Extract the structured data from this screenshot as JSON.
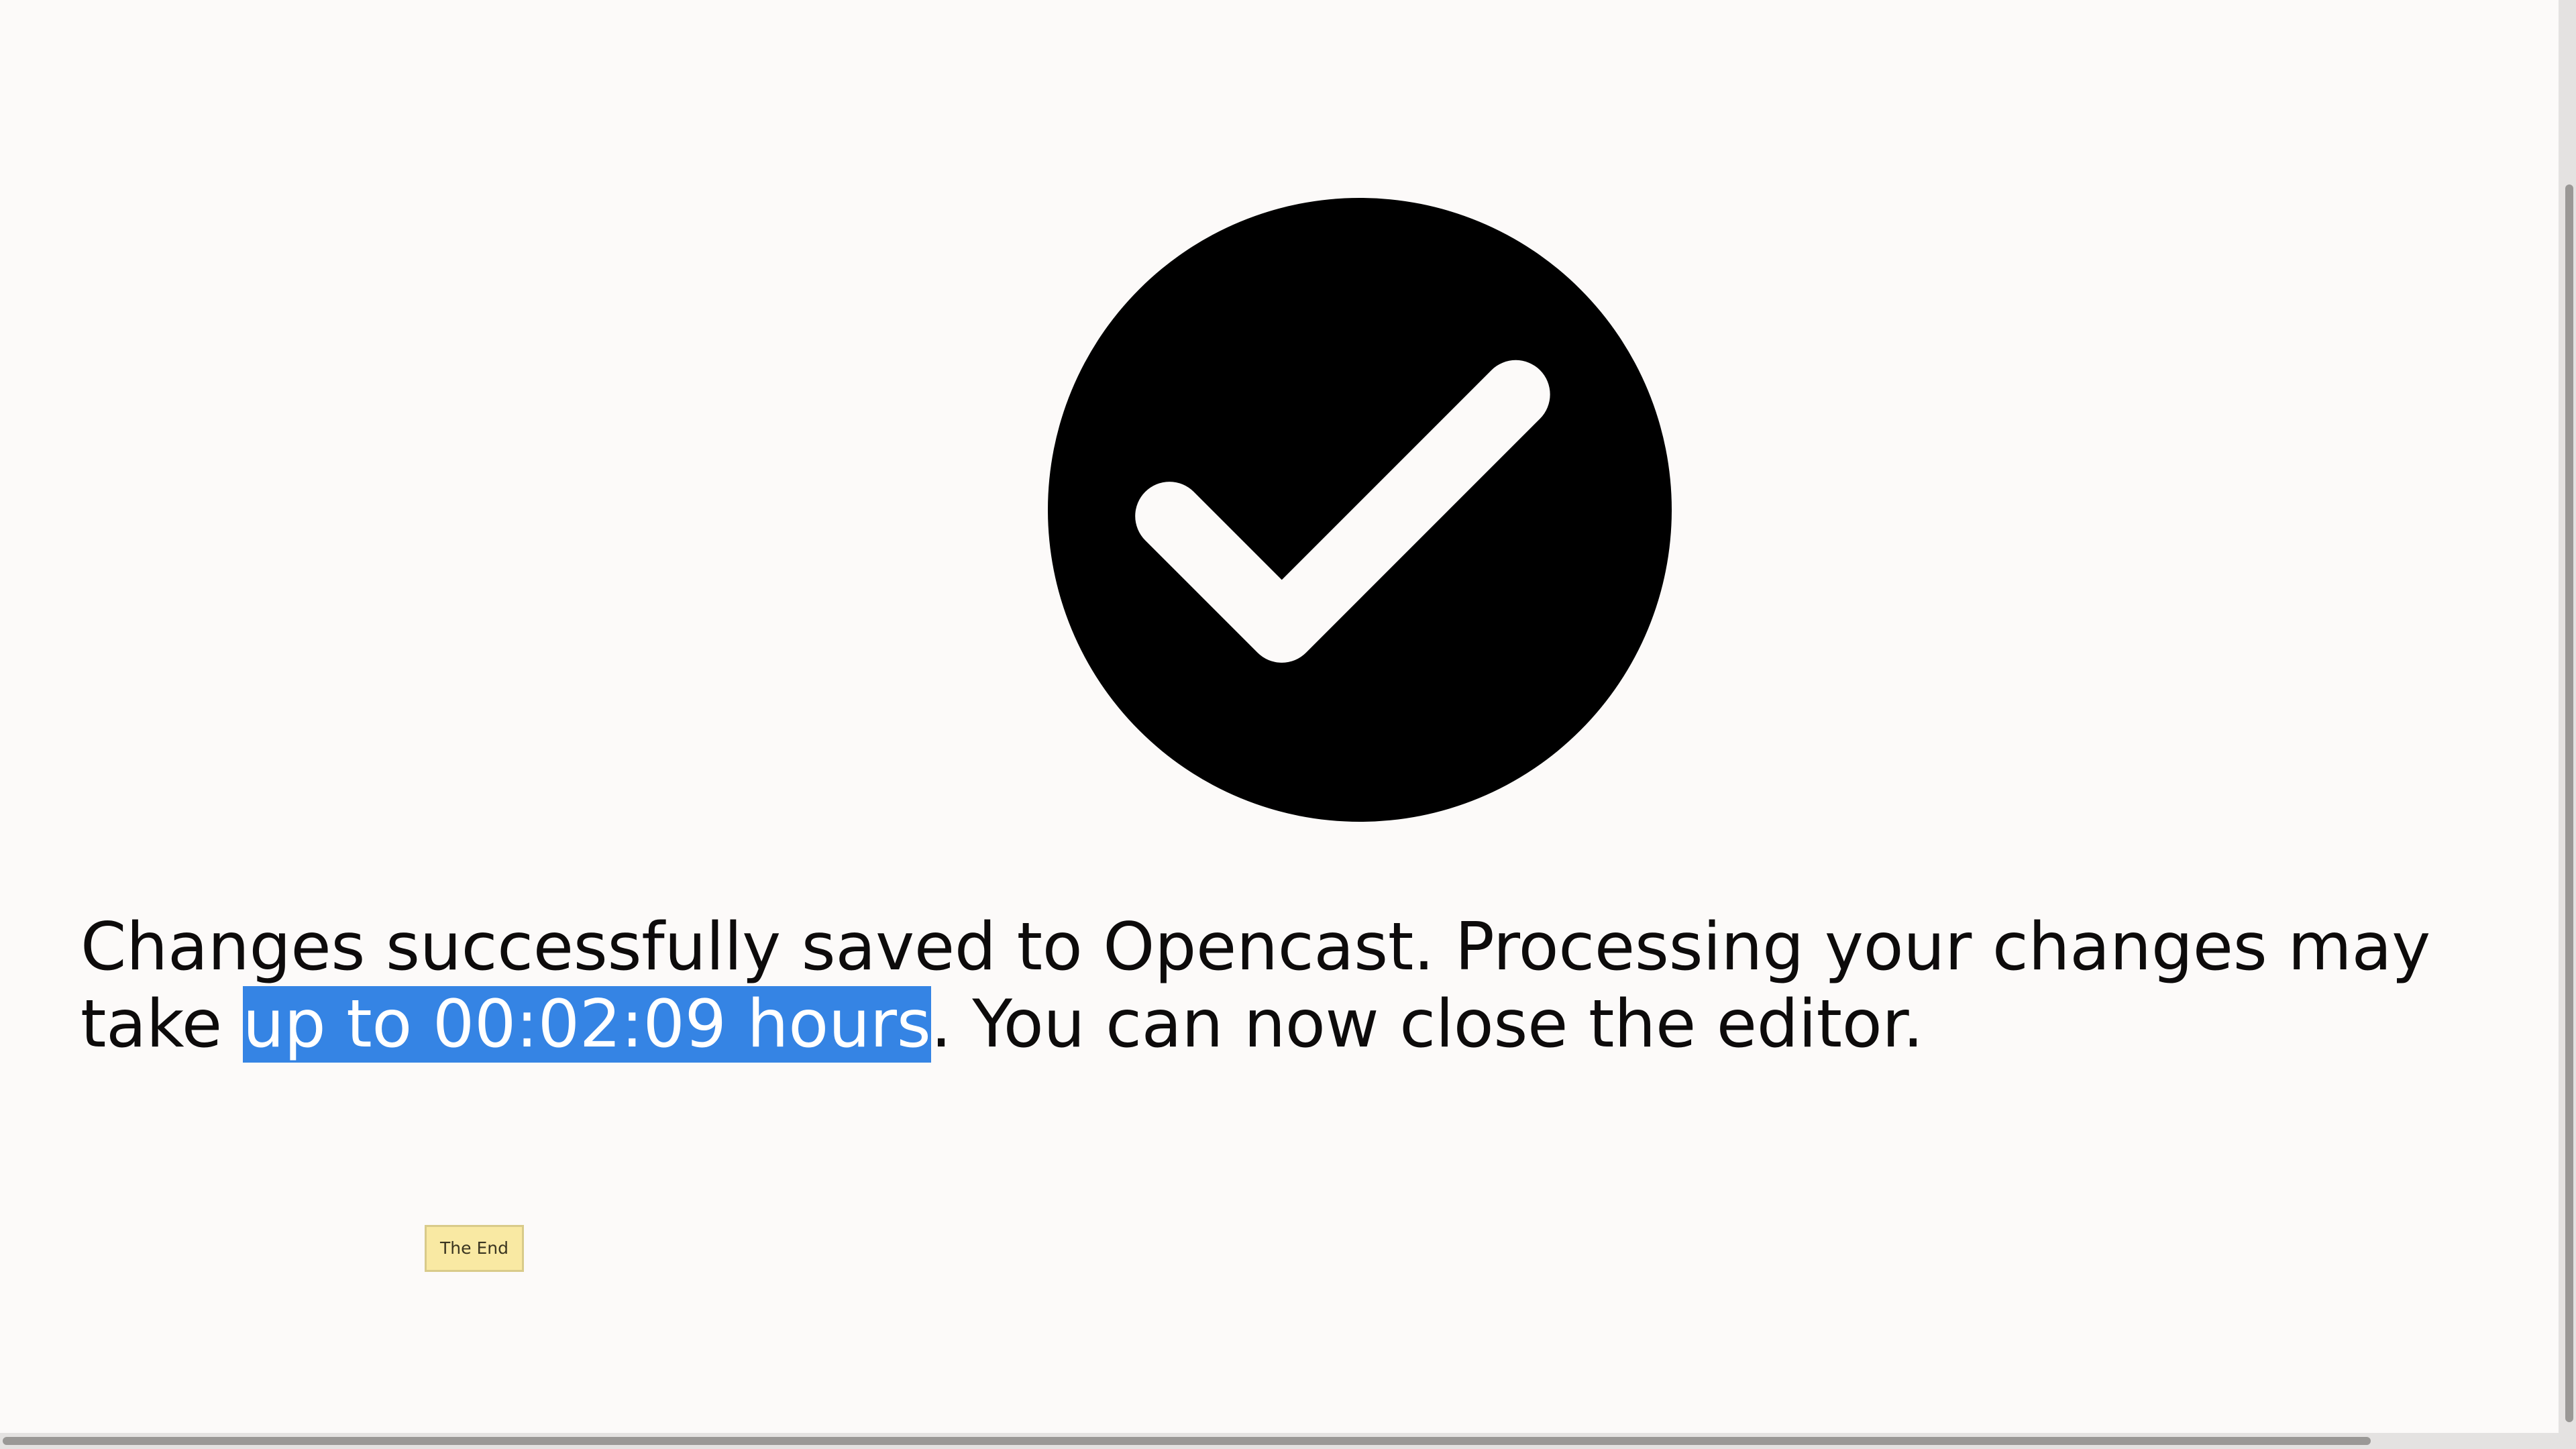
{
  "success": {
    "icon": "check-circle-icon",
    "message_before": "Changes successfully saved to Opencast. Processing your changes may take ",
    "message_highlight": "up to 00:02:09 hours",
    "message_after": ". You can now close the editor."
  },
  "tooltip": {
    "text": "The End"
  },
  "colors": {
    "background": "#fcfaf9",
    "text": "#0d0b0b",
    "selection": "#3584e4",
    "tooltip": "#f9e9a3"
  }
}
